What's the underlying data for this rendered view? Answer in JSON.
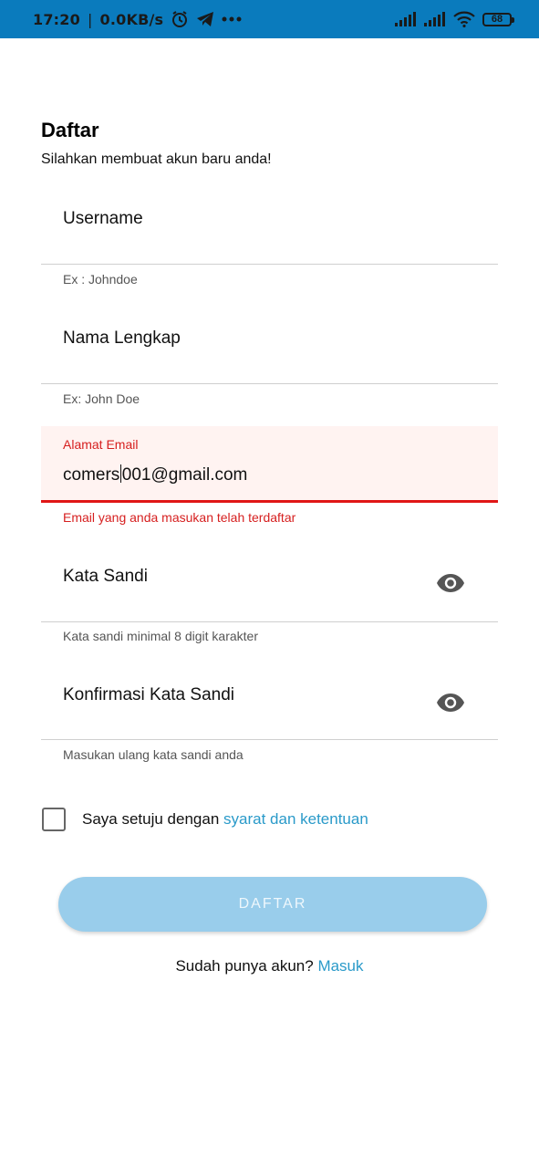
{
  "status_bar": {
    "time": "17:20",
    "network_speed": "0.0KB/s",
    "battery": "68",
    "icons": [
      "alarm-icon",
      "telegram-icon",
      "more-icon",
      "signal-icon",
      "signal-icon",
      "wifi-icon",
      "battery-icon"
    ]
  },
  "header": {
    "title": "Daftar",
    "subtitle": "Silahkan membuat akun baru anda!"
  },
  "form": {
    "username": {
      "label": "Username",
      "helper": "Ex : Johndoe"
    },
    "full_name": {
      "label": "Nama Lengkap",
      "helper": "Ex: John Doe"
    },
    "email": {
      "label": "Alamat Email",
      "value_before_caret": "comers",
      "value_after_caret": "001@gmail.com",
      "error": "Email yang anda masukan telah terdaftar"
    },
    "password": {
      "label": "Kata Sandi",
      "helper": "Kata sandi minimal 8 digit karakter"
    },
    "confirm_password": {
      "label": "Konfirmasi Kata Sandi",
      "helper": "Masukan ulang kata sandi anda"
    }
  },
  "terms": {
    "text": "Saya setuju dengan ",
    "link": "syarat dan ketentuan",
    "checked": false
  },
  "submit_button": {
    "label": "DAFTAR"
  },
  "login_prompt": {
    "text": "Sudah punya akun? ",
    "link": "Masuk"
  },
  "colors": {
    "status_bar": "#0a7bbd",
    "error": "#e01616",
    "link": "#2a9ac9",
    "button": "#99cdeb"
  }
}
